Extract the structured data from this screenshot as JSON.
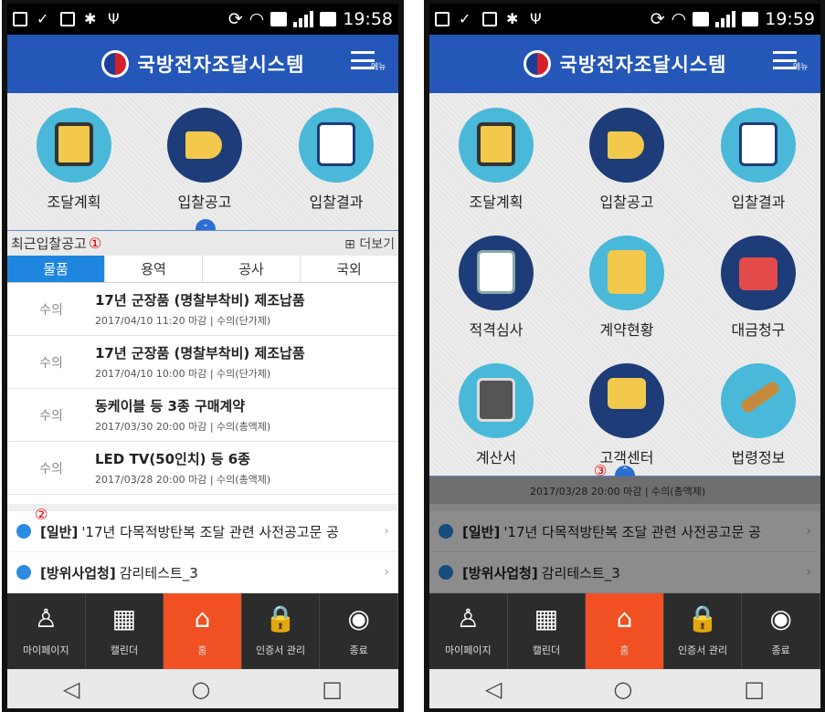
{
  "status_left": {
    "time": "19:58"
  },
  "status_right": {
    "time": "19:59"
  },
  "app": {
    "title": "국방전자조달시스템",
    "menu_label": "메뉴"
  },
  "left": {
    "tiles": [
      {
        "label": "조달계획",
        "icon": "clipboard-icon",
        "color": "#4ab8d8"
      },
      {
        "label": "입찰공고",
        "icon": "megaphone-icon",
        "color": "#1d3c78"
      },
      {
        "label": "입찰결과",
        "icon": "search-document-icon",
        "color": "#4ab8d8"
      }
    ],
    "recent": {
      "title": "최근입찰공고",
      "marker": "①",
      "more": "더보기",
      "tabs": [
        "물품",
        "용역",
        "공사",
        "국외"
      ],
      "rows": [
        {
          "type": "수의",
          "title": "17년 군장품 (명찰부착비) 제조납품",
          "sub": "2017/04/10 11:20 마감 | 수의(단가제)"
        },
        {
          "type": "수의",
          "title": "17년 군장품 (명찰부착비) 제조납품",
          "sub": "2017/04/10 10:00 마감 | 수의(단가제)"
        },
        {
          "type": "수의",
          "title": "동케이블 등 3종 구매계약",
          "sub": "2017/03/30 20:00 마감 | 수의(총액제)"
        },
        {
          "type": "수의",
          "title": "LED TV(50인치) 등 6종",
          "sub": "2017/03/28 20:00 마감 | 수의(총액제)"
        }
      ]
    },
    "notice_marker": "②"
  },
  "right": {
    "tiles": [
      {
        "label": "조달계획",
        "icon": "clipboard-icon"
      },
      {
        "label": "입찰공고",
        "icon": "megaphone-icon"
      },
      {
        "label": "입찰결과",
        "icon": "search-document-icon"
      },
      {
        "label": "적격심사",
        "icon": "contract-review-icon"
      },
      {
        "label": "계약현황",
        "icon": "folder-icon"
      },
      {
        "label": "대금청구",
        "icon": "invoice-envelope-icon"
      },
      {
        "label": "계산서",
        "icon": "calculator-icon"
      },
      {
        "label": "고객센터",
        "icon": "phone-chat-icon"
      },
      {
        "label": "법령정보",
        "icon": "gavel-icon"
      }
    ],
    "peek_text": "2017/03/28 20:00 마감 | 수의(총액제)",
    "marker": "③"
  },
  "notices": [
    {
      "category": "[일반]",
      "text": "'17년 다목적방탄복 조달 관련 사전공고문 공"
    },
    {
      "category": "[방위사업청]",
      "text": "감리테스트_3"
    }
  ],
  "bottom_nav": [
    {
      "label": "마이페이지",
      "icon": "user-chat-icon",
      "glyph": "♙"
    },
    {
      "label": "캘린더",
      "icon": "calendar-icon",
      "glyph": "▦"
    },
    {
      "label": "홈",
      "icon": "home-icon",
      "glyph": "⌂"
    },
    {
      "label": "인증서 관리",
      "icon": "lock-icon",
      "glyph": "🔒"
    },
    {
      "label": "종료",
      "icon": "power-icon",
      "glyph": "◉"
    }
  ],
  "android": {
    "back": "◁",
    "home": "○",
    "recent": "□"
  },
  "colors": {
    "header": "#2457b8",
    "tab_active": "#1f86e0",
    "home_button": "#f05022"
  }
}
